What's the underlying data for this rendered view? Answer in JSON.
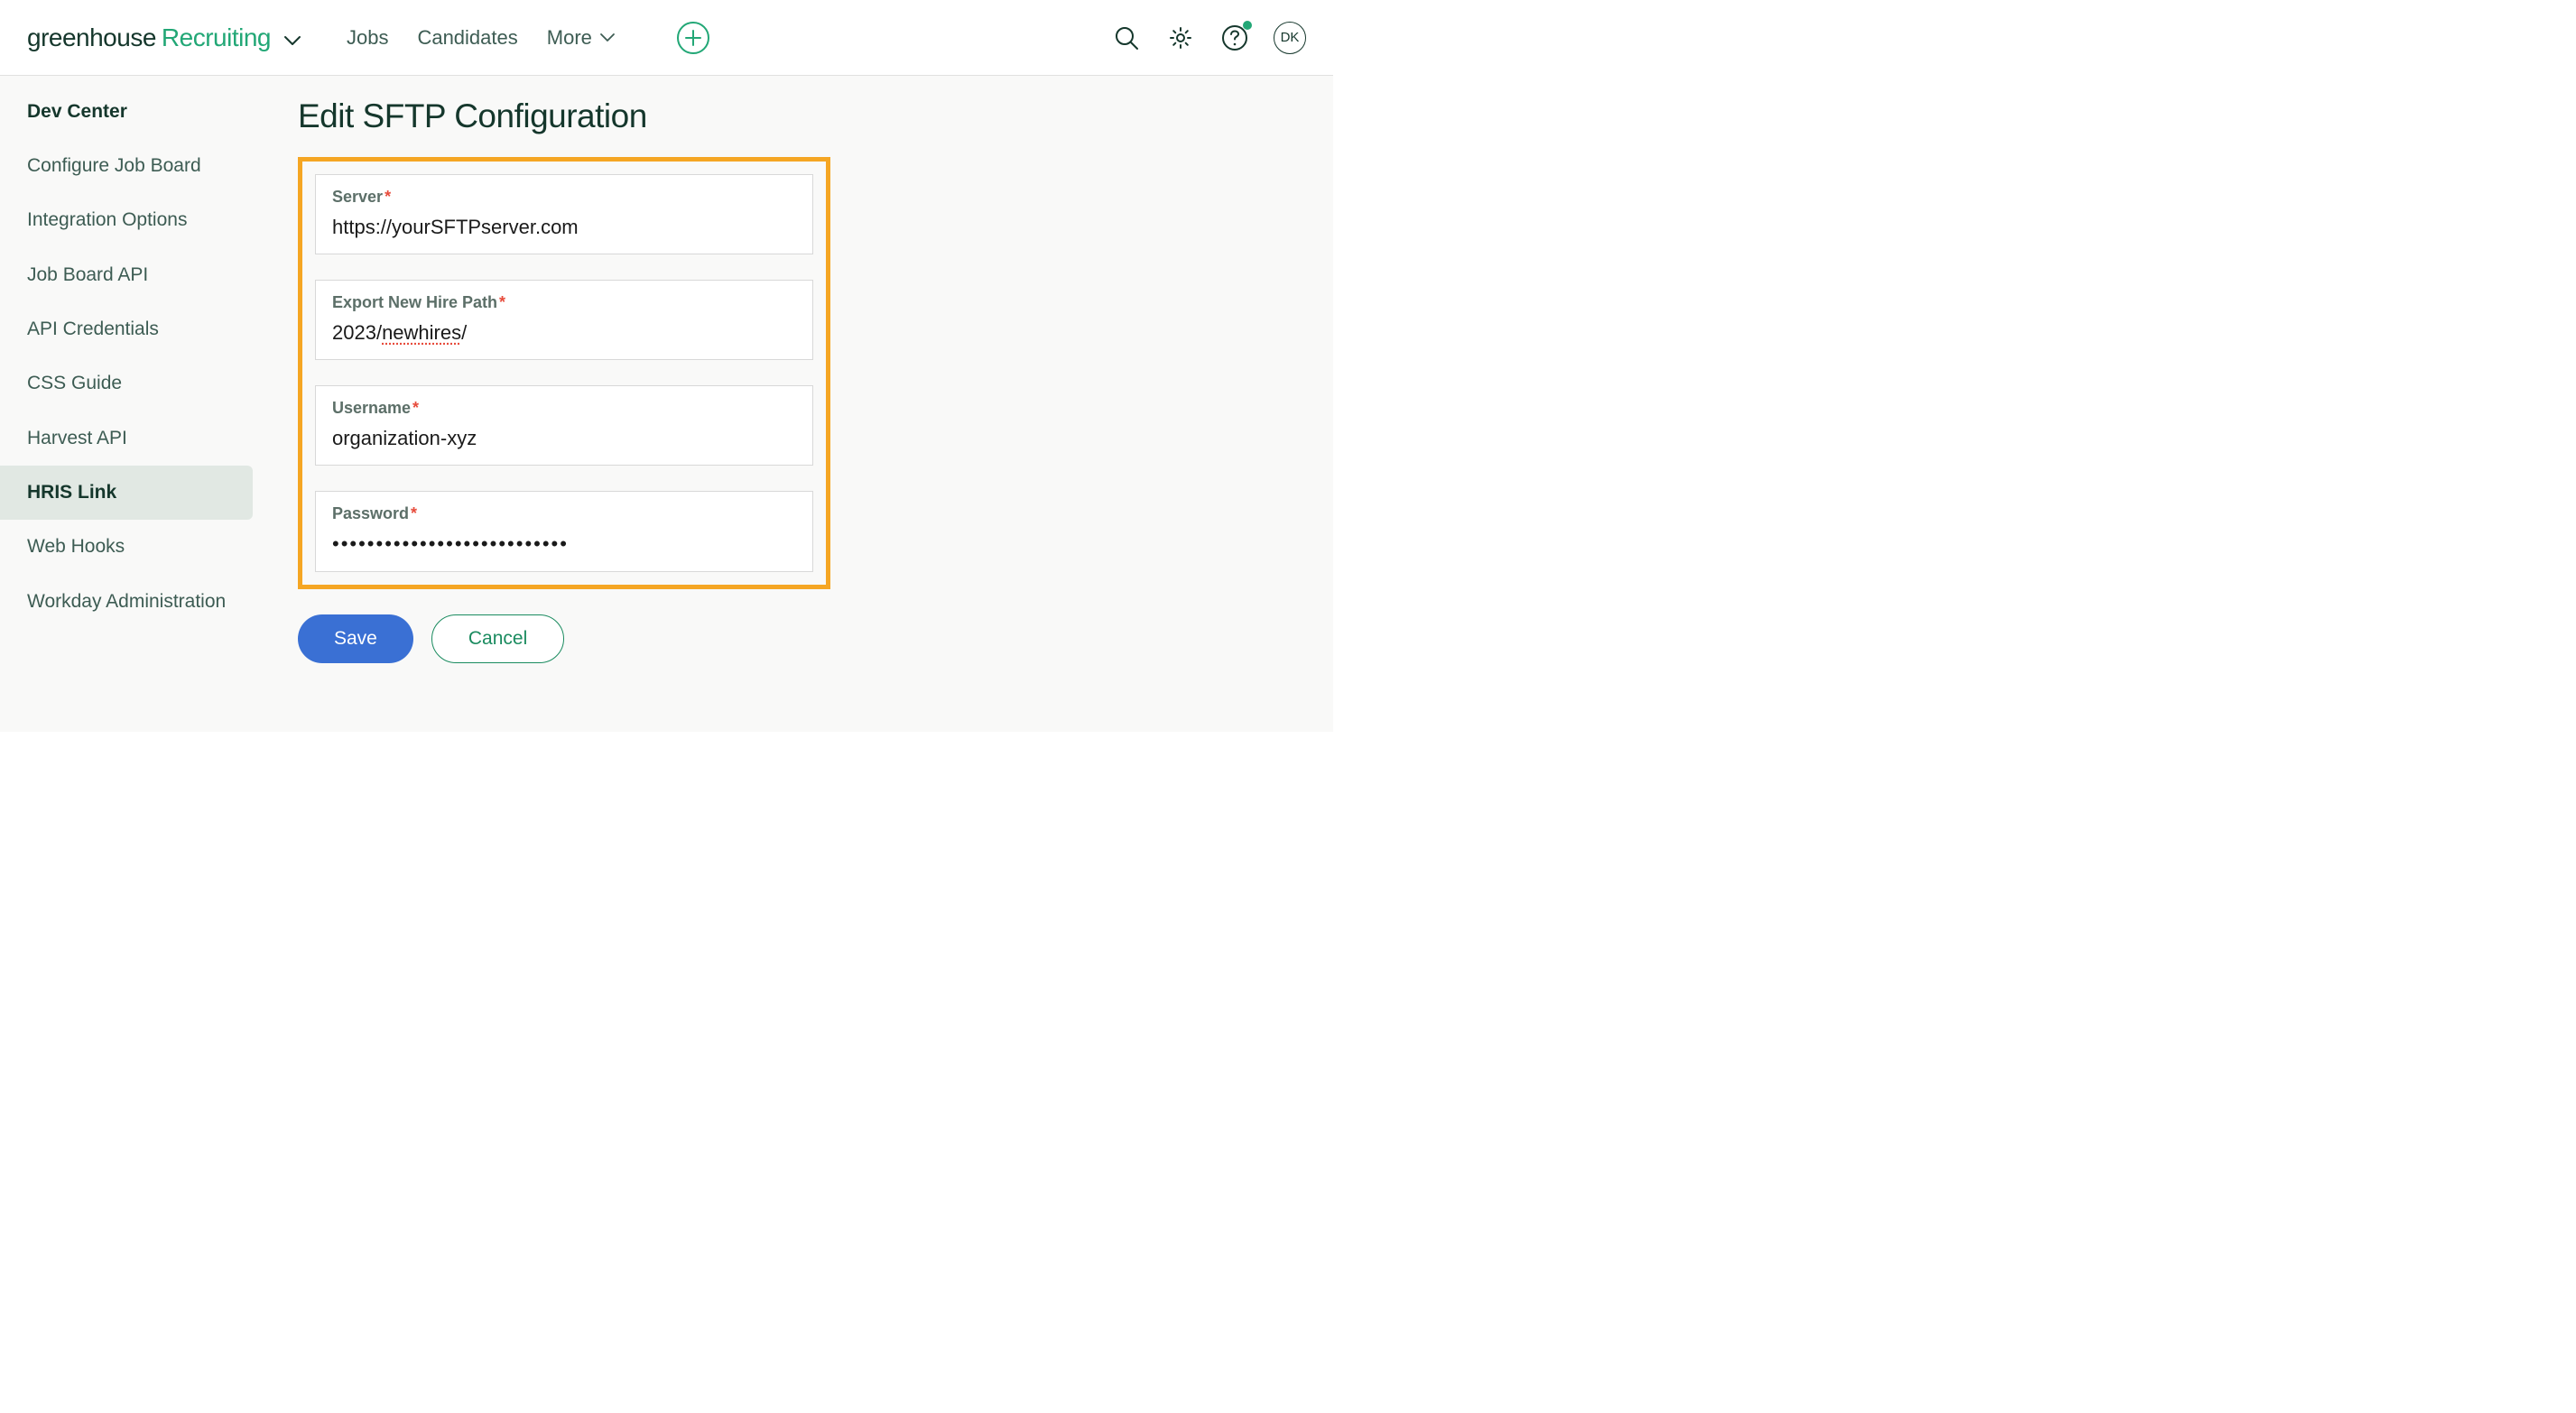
{
  "header": {
    "logo_primary": "greenhouse",
    "logo_secondary": "Recruiting",
    "nav": {
      "jobs": "Jobs",
      "candidates": "Candidates",
      "more": "More"
    },
    "avatar_initials": "DK"
  },
  "sidebar": {
    "title": "Dev Center",
    "items": [
      {
        "label": "Configure Job Board",
        "active": false
      },
      {
        "label": "Integration Options",
        "active": false
      },
      {
        "label": "Job Board API",
        "active": false
      },
      {
        "label": "API Credentials",
        "active": false
      },
      {
        "label": "CSS Guide",
        "active": false
      },
      {
        "label": "Harvest API",
        "active": false
      },
      {
        "label": "HRIS Link",
        "active": true
      },
      {
        "label": "Web Hooks",
        "active": false
      },
      {
        "label": "Workday Administration",
        "active": false
      }
    ]
  },
  "main": {
    "title": "Edit SFTP Configuration",
    "fields": {
      "server": {
        "label": "Server",
        "required": true,
        "value": "https://yourSFTPserver.com"
      },
      "export_path": {
        "label": "Export New Hire Path",
        "required": true,
        "value_pre": "2023/",
        "value_mid": "newhires",
        "value_post": "/"
      },
      "username": {
        "label": "Username",
        "required": true,
        "value": "organization-xyz"
      },
      "password": {
        "label": "Password",
        "required": true,
        "value_mask": "•••••••••••••••••••••••••••"
      }
    },
    "actions": {
      "save": "Save",
      "cancel": "Cancel"
    }
  }
}
